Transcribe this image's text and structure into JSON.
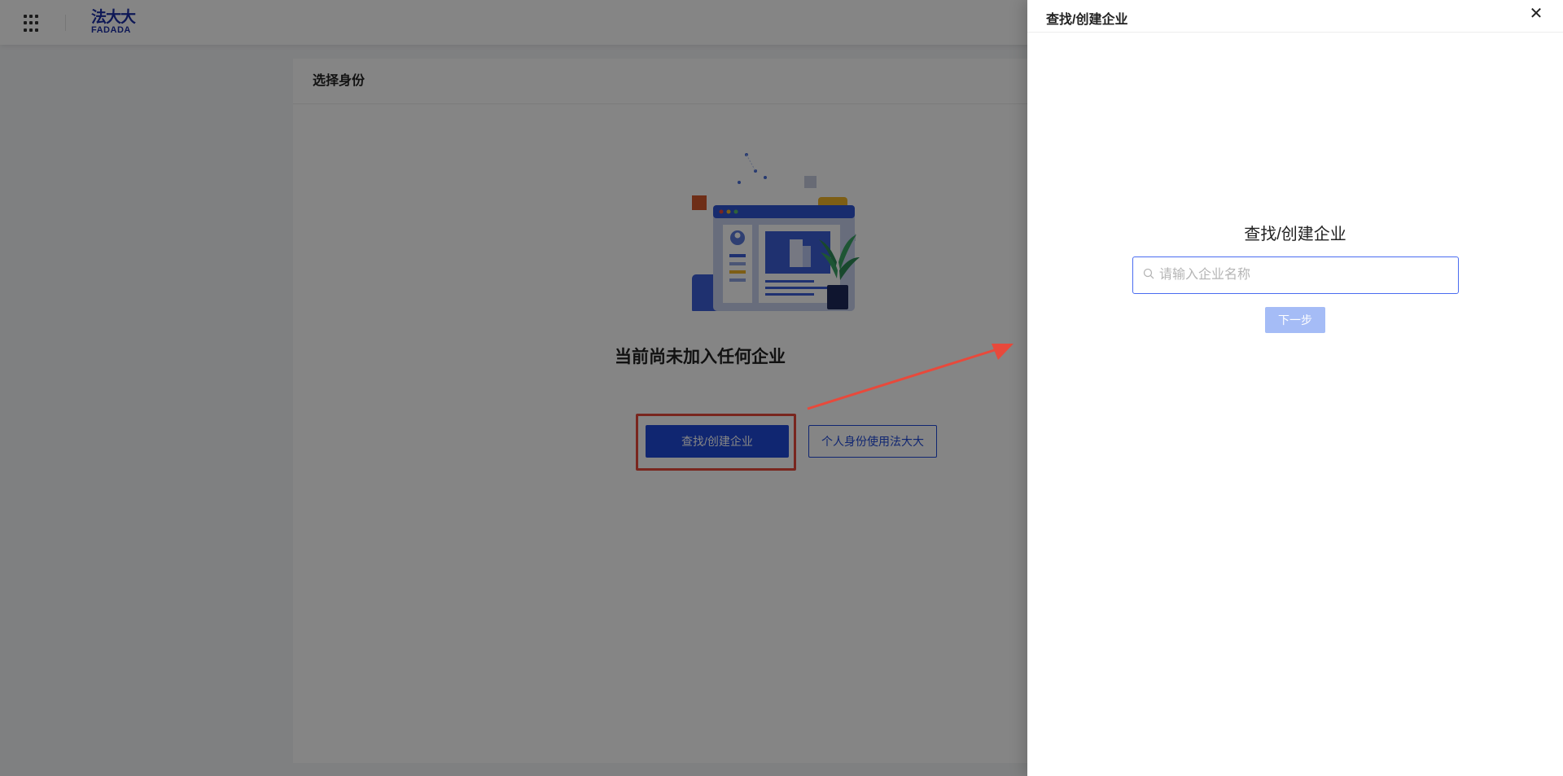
{
  "topbar": {
    "apps_icon": "grid-icon",
    "logo_cn": "法大大",
    "logo_en": "FADADA"
  },
  "card": {
    "title": "选择身份",
    "empty_title": "当前尚未加入任何企业",
    "primary_button": "查找/创建企业",
    "secondary_button": "个人身份使用法大大"
  },
  "drawer": {
    "title": "查找/创建企业",
    "close_icon": "close-icon",
    "heading": "查找/创建企业",
    "search": {
      "placeholder": "请输入企业名称",
      "value": ""
    },
    "next_button": "下一步"
  },
  "colors": {
    "primary": "#2049d8",
    "annotation": "#e8493b",
    "disabled_button": "#a5bcf6"
  }
}
